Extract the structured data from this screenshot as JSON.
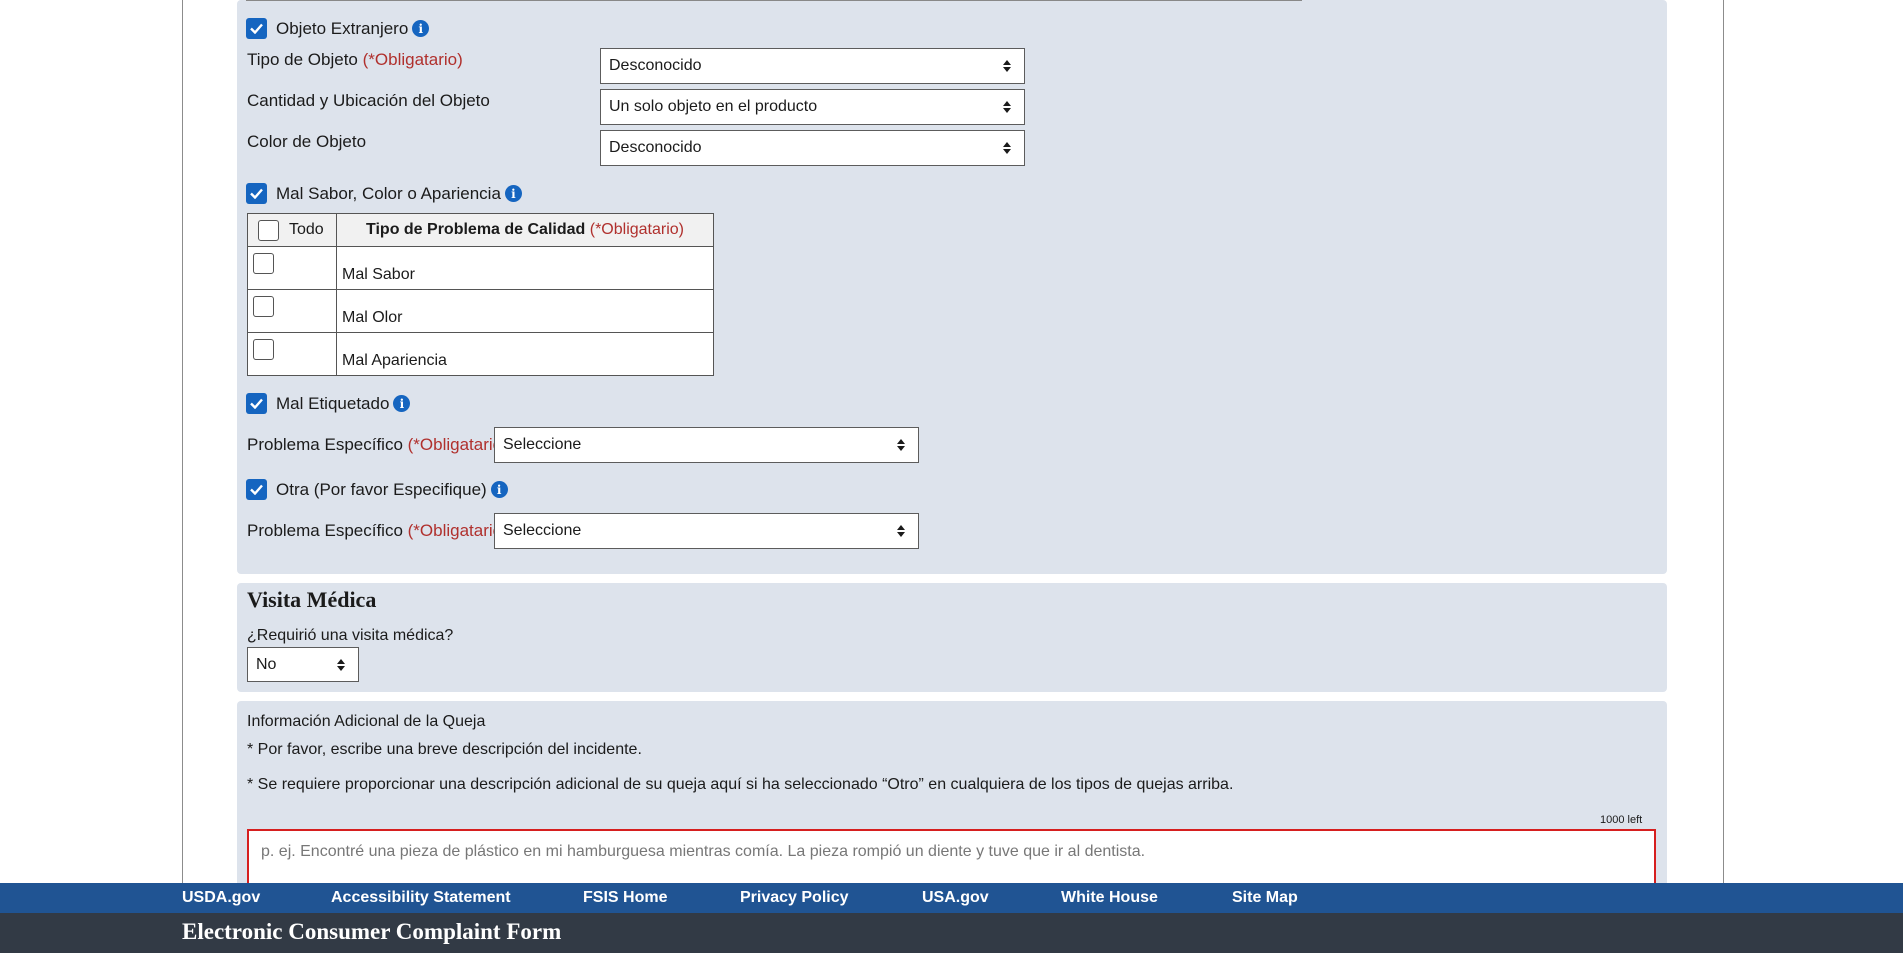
{
  "foreign_object": {
    "label": "Objeto Extranjero",
    "checked": true,
    "fields": [
      {
        "label": "Tipo de Objeto",
        "required": "(*Obligatario)",
        "value": "Desconocido"
      },
      {
        "label": "Cantidad y Ubicación del Objeto",
        "required": "",
        "value": "Un solo objeto en el producto"
      },
      {
        "label": "Color de Objeto",
        "required": "",
        "value": "Desconocido"
      }
    ]
  },
  "quality": {
    "label": "Mal Sabor, Color o Apariencia",
    "checked": true,
    "table": {
      "all_label": "Todo",
      "header": "Tipo de Problema de Calidad",
      "header_required": "(*Obligatario)",
      "rows": [
        "Mal Sabor",
        "Mal Olor",
        "Mal Apariencia"
      ]
    }
  },
  "mislabeled": {
    "label": "Mal Etiquetado",
    "checked": true,
    "field_label": "Problema Específico",
    "required": "(*Obligatario)",
    "value": "Seleccione"
  },
  "other": {
    "label": "Otra (Por favor Especifique)",
    "checked": true,
    "field_label": "Problema Específico",
    "required": "(*Obligatario)",
    "value": "Seleccione"
  },
  "medical": {
    "title": "Visita Médica",
    "question": "¿Requirió una visita médica?",
    "value": "No"
  },
  "additional": {
    "title": "Información Adicional de la Queja",
    "note1": "* Por favor, escribe una breve descripción del incidente.",
    "note2": "* Se requiere proporcionar una descripción adicional de su queja aquí si ha seleccionado “Otro” en cualquiera de los tipos de quejas arriba.",
    "counter": "1000 left",
    "placeholder": "p. ej. Encontré una pieza de plástico en mi hamburguesa mientras comía. La pieza rompió un diente y tuve que ir al dentista."
  },
  "footer_links": [
    "USDA.gov",
    "Accessibility Statement",
    "FSIS Home",
    "Privacy Policy",
    "USA.gov",
    "White House",
    "Site Map"
  ],
  "footer_title": "Electronic Consumer Complaint Form",
  "colors": {
    "accent": "#1565c0",
    "required": "#b0302d",
    "link_bar": "#205493",
    "footer": "#323a45",
    "panel": "#dde3ec"
  }
}
